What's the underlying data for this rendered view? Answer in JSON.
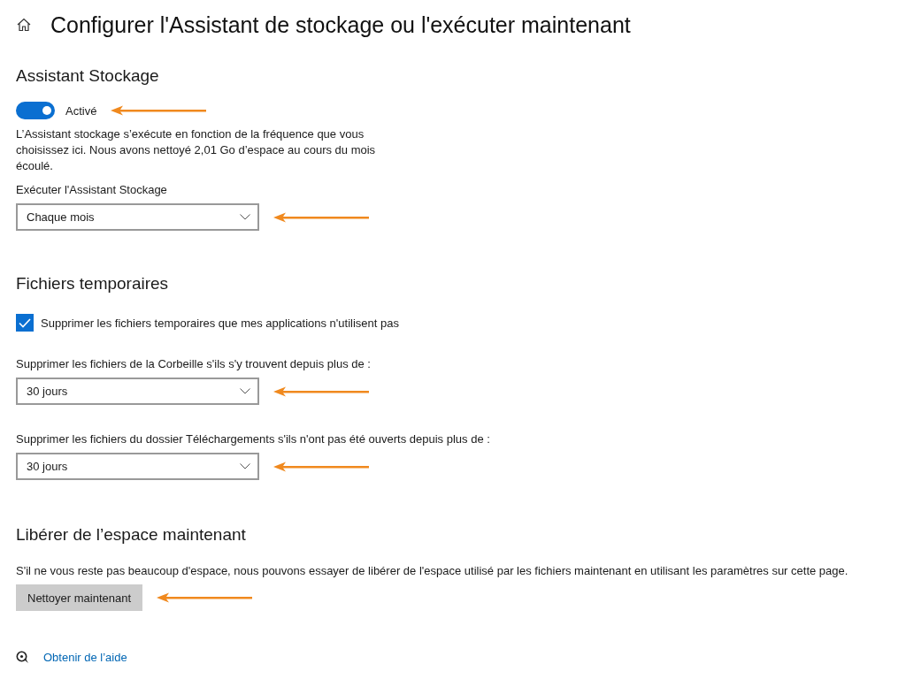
{
  "page": {
    "title": "Configurer l'Assistant de stockage ou l'exécuter maintenant"
  },
  "storage_sense": {
    "heading": "Assistant Stockage",
    "toggle": {
      "label": "Activé",
      "on": true,
      "arrow": true
    },
    "description": "L’Assistant stockage s’exécute en fonction de la fréquence que vous choisissez ici. Nous avons nettoyé 2,01 Go d’espace au cours du mois écoulé.",
    "run_dropdown": {
      "label": "Exécuter l'Assistant Stockage",
      "value": "Chaque mois",
      "arrow": true
    }
  },
  "temporary_files": {
    "heading": "Fichiers temporaires",
    "checkbox": {
      "label": "Supprimer les fichiers temporaires que mes applications n'utilisent pas",
      "checked": true
    },
    "dropdowns": [
      {
        "label": "Supprimer les fichiers de la Corbeille s'ils s'y trouvent depuis plus de :",
        "value": "30 jours",
        "arrow": true
      },
      {
        "label": "Supprimer les fichiers du dossier Téléchargements s'ils n'ont pas été ouverts depuis plus de :",
        "value": "30 jours",
        "arrow": true
      }
    ]
  },
  "free_space": {
    "heading": "Libérer de l’espace maintenant",
    "description": "S'il ne vous reste pas beaucoup d'espace, nous pouvons essayer de libérer de l'espace utilisé par les fichiers maintenant en utilisant les paramètres sur cette page.",
    "button": {
      "label": "Nettoyer maintenant",
      "arrow": true
    }
  },
  "help_link": "Obtenir de l’aide"
}
